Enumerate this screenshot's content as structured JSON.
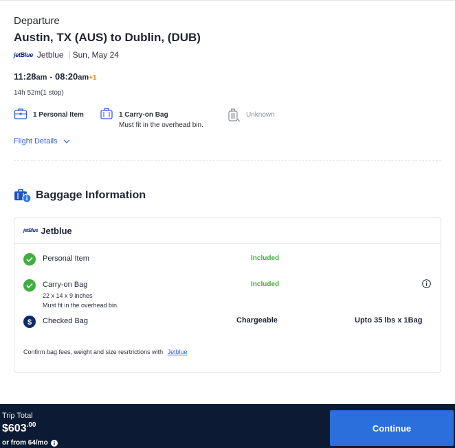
{
  "header": {
    "section_label": "Departure",
    "route": "Austin, TX (AUS) to Dublin, (DUB)",
    "airline_logo_text": "jetBlue",
    "airline": "Jetblue",
    "date": "Sun, May 24"
  },
  "flight": {
    "depart_time": "11:28",
    "depart_ampm": "am",
    "time_separator": " - ",
    "arrive_time": "08:20",
    "arrive_ampm": "am",
    "day_offset": "+1",
    "duration": "14h 52m(1 stop)"
  },
  "bag_summary": {
    "personal_item": "1 Personal Item",
    "carry_on": "1 Carry-on Bag",
    "carry_on_note": "Must fit in the overhead bin.",
    "checked": "Unknown"
  },
  "flight_details_link": "Flight Details",
  "baggage": {
    "title": "Baggage Information",
    "airline_logo_text": "jetBlue",
    "airline": "Jetblue",
    "items": [
      {
        "name": "Personal Item",
        "status": "Included"
      },
      {
        "name": "Carry-on Bag",
        "status": "Included",
        "dims": "22 x 14 x 9 inches",
        "note": "Must fit in the overhead bin."
      },
      {
        "name": "Checked Bag",
        "status": "Chargeable",
        "allowance": "Upto 35 lbs x 1Bag"
      }
    ],
    "confirm_text": "Confirm bag fees, weight and size resrtrictions with",
    "confirm_link": "Jetblue"
  },
  "footer": {
    "trip_total_label": "Trip Total",
    "price_main": "$603",
    "price_cents": ".00",
    "monthly": "or from 64/mo",
    "continue_label": "Continue"
  },
  "colors": {
    "included": "#3fae3f",
    "link": "#2b5fd9",
    "footer_bg": "#0d1a33",
    "continue_bg": "#2a6fdb",
    "day_offset": "#f07a1a"
  }
}
